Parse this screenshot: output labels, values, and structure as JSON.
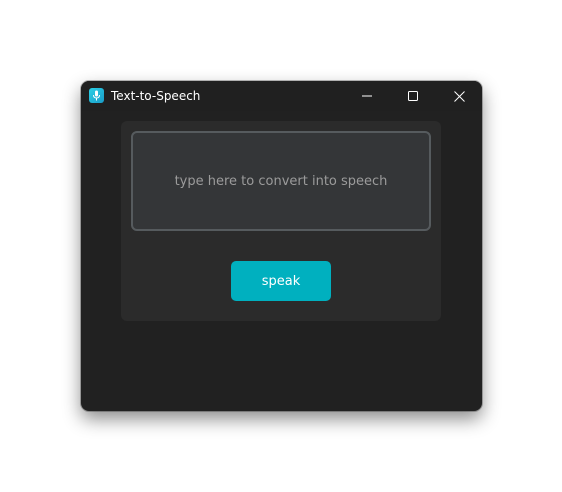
{
  "window": {
    "title": "Text-to-Speech",
    "app_icon": "microphone-icon",
    "controls": {
      "minimize_icon": "minimize-icon",
      "maximize_icon": "maximize-icon",
      "close_icon": "close-icon"
    }
  },
  "main": {
    "textbox": {
      "value": "",
      "placeholder": "type here to convert into speech"
    },
    "speak_button": {
      "label": "speak"
    }
  },
  "colors": {
    "window_bg": "#212121",
    "panel_bg": "#2b2b2b",
    "textbox_bg": "#343638",
    "textbox_border": "#565b5e",
    "accent": "#00b0bf",
    "placeholder_text": "#9b9b9b"
  }
}
